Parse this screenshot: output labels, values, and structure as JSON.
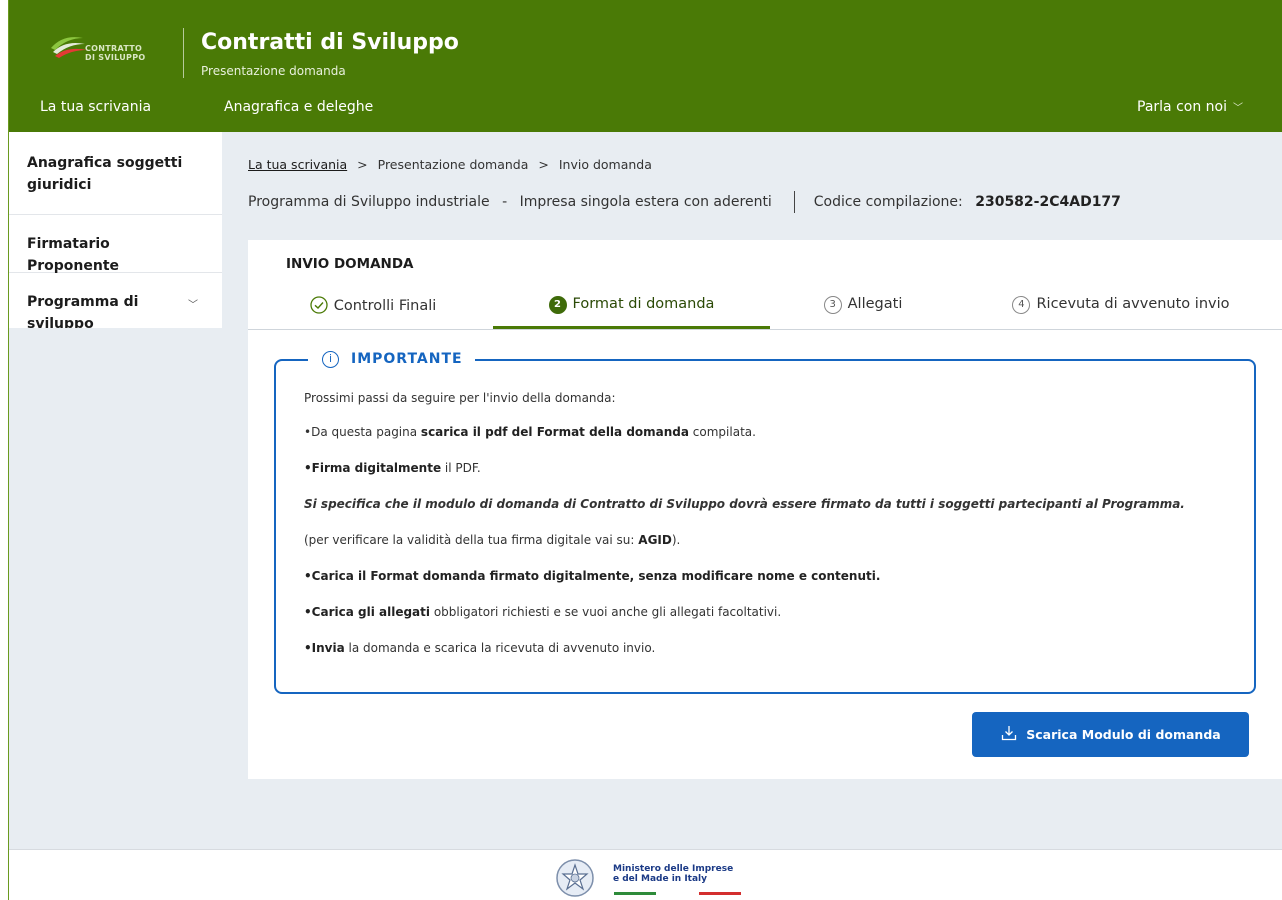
{
  "header": {
    "logo_text_1": "CONTRATTO",
    "logo_text_2": "DI SVILUPPO",
    "title": "Contratti di Sviluppo",
    "subtitle": "Presentazione domanda",
    "nav": {
      "desk": "La tua scrivania",
      "registry": "Anagrafica e deleghe",
      "talk": "Parla con noi"
    }
  },
  "sidebar": {
    "items": [
      {
        "label": "Anagrafica soggetti giuridici"
      },
      {
        "label": "Firmatario Proponente"
      },
      {
        "label": "Programma di sviluppo"
      }
    ]
  },
  "breadcrumb": {
    "home": "La tua scrivania",
    "step2": "Presentazione domanda",
    "step3": "Invio domanda",
    "separator": ">"
  },
  "info": {
    "program": "Programma di Sviluppo industriale",
    "dash": "-",
    "type": "Impresa singola estera con aderenti",
    "code_label": "Codice compilazione:",
    "code_value": "230582-2C4AD177"
  },
  "panel": {
    "title": "INVIO DOMANDA",
    "tabs": [
      {
        "num": "",
        "label": "Controlli Finali",
        "state": "done"
      },
      {
        "num": "2",
        "label": "Format di domanda",
        "state": "active"
      },
      {
        "num": "3",
        "label": "Allegati",
        "state": "todo"
      },
      {
        "num": "4",
        "label": "Ricevuta di avvenuto invio",
        "state": "todo"
      }
    ],
    "important": {
      "heading": "IMPORTANTE",
      "intro": "Prossimi passi da seguire per l'invio della domanda:",
      "l1_pre": "•Da questa pagina ",
      "l1_b": "scarica il pdf del Format della domanda",
      "l1_post": " compilata.",
      "l2_b": "•Firma digitalmente",
      "l2_post": " il PDF.",
      "l3": "Si specifica che il modulo di domanda di Contratto di Sviluppo dovrà essere firmato da tutti i soggetti partecipanti al Programma.",
      "l4_pre": "(per verificare la validità della tua firma digitale vai su: ",
      "l4_b": "AGID",
      "l4_post": ").",
      "l5": "•Carica il Format domanda firmato digitalmente, senza modificare nome e contenuti.",
      "l6_b": "•Carica gli allegati",
      "l6_post": " obbligatori richiesti e se vuoi anche gli allegati facoltativi.",
      "l7_b": "•Invia",
      "l7_post": " la domanda e scarica la ricevuta di avvenuto invio."
    },
    "download_button": "Scarica Modulo di domanda"
  },
  "footer": {
    "ministry_1": "Ministero delle Imprese",
    "ministry_2": "e del Made in Italy"
  },
  "colors": {
    "header_green": "#4a7a06",
    "accent_blue": "#1565c0",
    "page_bg": "#e8edf2"
  }
}
